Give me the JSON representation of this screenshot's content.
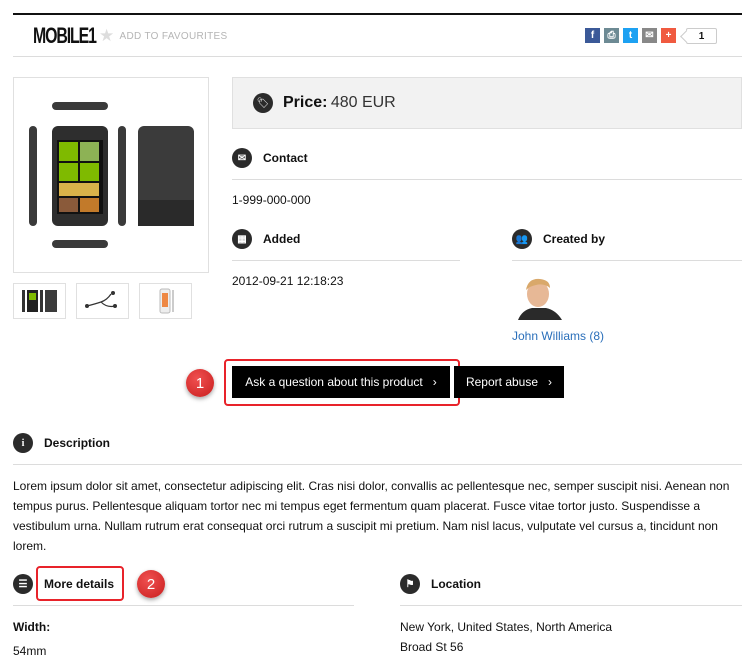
{
  "header": {
    "title": "MOBILE1",
    "add_to_favourites": "ADD TO FAVOURITES",
    "share_buttons": [
      {
        "name": "facebook",
        "glyph": "f",
        "color": "#3b5998"
      },
      {
        "name": "print",
        "glyph": "⎙",
        "color": "#6d8a94"
      },
      {
        "name": "twitter",
        "glyph": "t",
        "color": "#1da1f2"
      },
      {
        "name": "email",
        "glyph": "✉",
        "color": "#888888"
      },
      {
        "name": "more",
        "glyph": "+",
        "color": "#f05a40"
      }
    ],
    "share_count": "1"
  },
  "price": {
    "label": "Price:",
    "value": "480 EUR"
  },
  "contact": {
    "heading": "Contact",
    "phone": "1-999-000-000"
  },
  "added": {
    "heading": "Added",
    "date": "2012-09-21 12:18:23"
  },
  "created_by": {
    "heading": "Created by",
    "user": "John Williams (8)"
  },
  "actions": {
    "ask_question": "Ask a question about this product",
    "report_abuse": "Report abuse",
    "chevron": "›"
  },
  "annotations": {
    "badge1": "1",
    "badge2": "2"
  },
  "description": {
    "heading": "Description",
    "text": "Lorem ipsum dolor sit amet, consectetur adipiscing elit. Cras nisi dolor, convallis ac pellentesque nec, semper suscipit nisi. Aenean non tempus purus. Pellentesque aliquam tortor nec mi tempus eget fermentum quam placerat. Fusce vitae tortor justo. Suspendisse a vestibulum urna. Nullam rutrum erat consequat orci rutrum a suscipit mi pretium. Nam nisl lacus, vulputate vel cursus a, tincidunt non lorem."
  },
  "more_details": {
    "heading": "More details",
    "fields": [
      {
        "label": "Width:",
        "value": "54mm"
      }
    ]
  },
  "location": {
    "heading": "Location",
    "line1": "New York, United States, North America",
    "line2": "Broad St 56"
  }
}
